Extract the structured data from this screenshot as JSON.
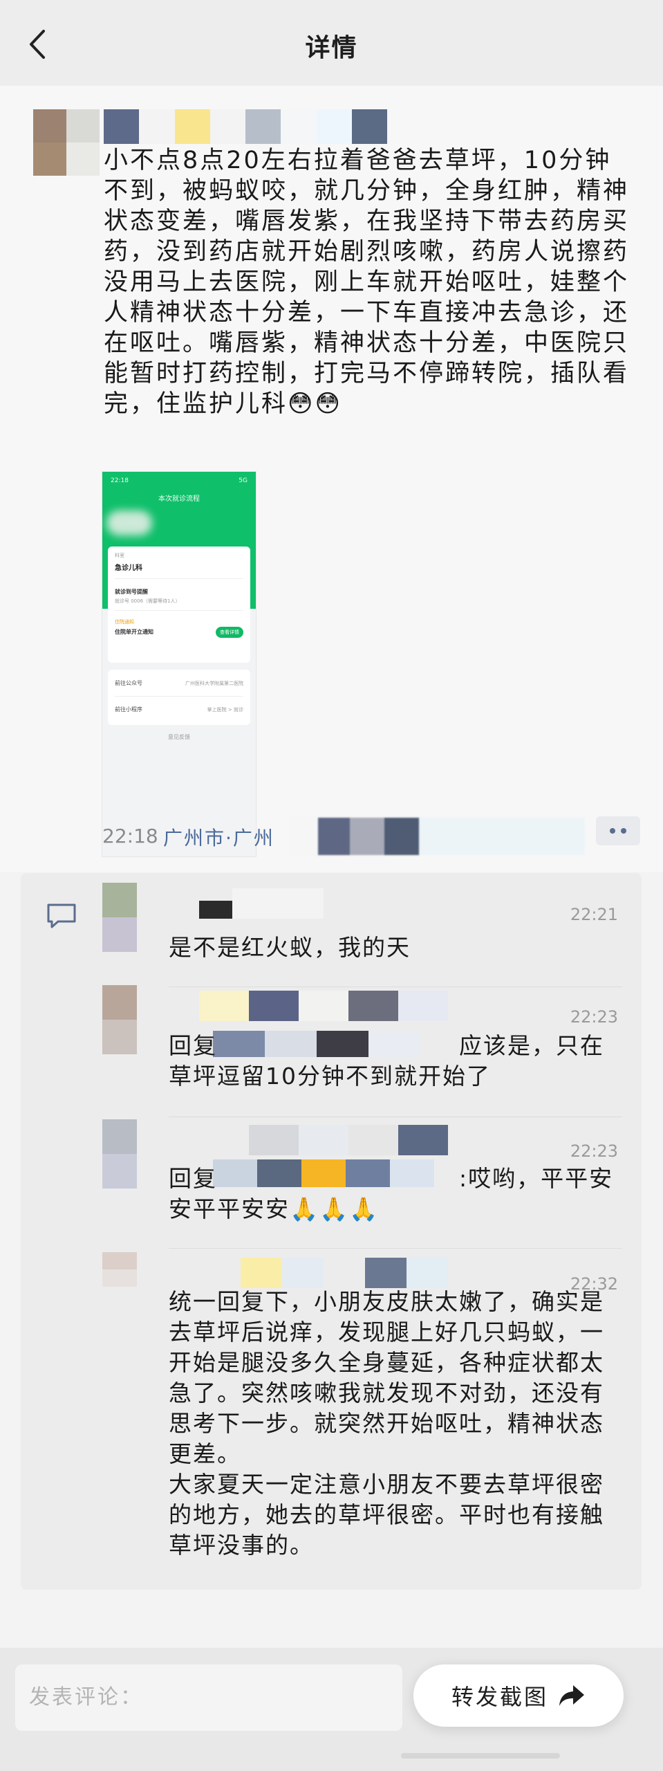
{
  "header": {
    "title": "详情"
  },
  "post": {
    "text": "小不点8点20左右拉着爸爸去草坪，10分钟不到，被蚂蚁咬，就几分钟，全身红肿，精神状态变差，嘴唇发紫，在我坚持下带去药房买药，没到药店就开始剧烈咳嗽，药房人说擦药没用马上去医院，刚上车就开始呕吐，娃整个人精神状态十分差，一下车直接冲去急诊，还在呕吐。嘴唇紫，精神状态十分差，中医院只能暂时打药控制，打完马不停蹄转院，插队看完，住监护儿科😳😳",
    "time": "22:18",
    "location": "广州市·广州",
    "screenshot": {
      "status_time": "22:18",
      "status_right": "5G",
      "title": "本次就诊流程",
      "dept_label": "科室",
      "dept": "急诊儿科",
      "item1": "就诊到号提醒",
      "item1_sub": "就诊号 0006（需要等待1人）",
      "tag": "住院通知",
      "item2": "住院单开立通知",
      "btn": "查看详情",
      "row1_l": "前往公众号",
      "row1_r": "广州医科大学附属第二医院",
      "row2_l": "前往小程序",
      "row2_r": "掌上医院 > 就诊",
      "feedback": "意见反馈"
    }
  },
  "comments": [
    {
      "time": "22:21",
      "text": "是不是红火蚁，我的天"
    },
    {
      "time": "22:23",
      "text": "回复　　　　　　　　　　应该是，只在草坪逗留10分钟不到就开始了"
    },
    {
      "time": "22:23",
      "text": "回复　　　　　　　　　　:哎哟，平平安安平平安安🙏🙏🙏"
    },
    {
      "time": "22:32",
      "text": "统一回复下，小朋友皮肤太嫩了，确实是去草坪后说痒，发现腿上好几只蚂蚁，一开始是腿没多久全身蔓延，各种症状都太急了。突然咳嗽我就发现不对劲，还没有思考下一步。就突然开始呕吐，精神状态更差。\n大家夏天一定注意小朋友不要去草坪很密的地方，她去的草坪很密。平时也有接触草坪没事的。"
    }
  ],
  "bottom": {
    "input_placeholder": "发表评论：",
    "share_label": "转发截图"
  },
  "colors": {
    "link": "#4a6a9a",
    "green": "#0fbf6a"
  }
}
